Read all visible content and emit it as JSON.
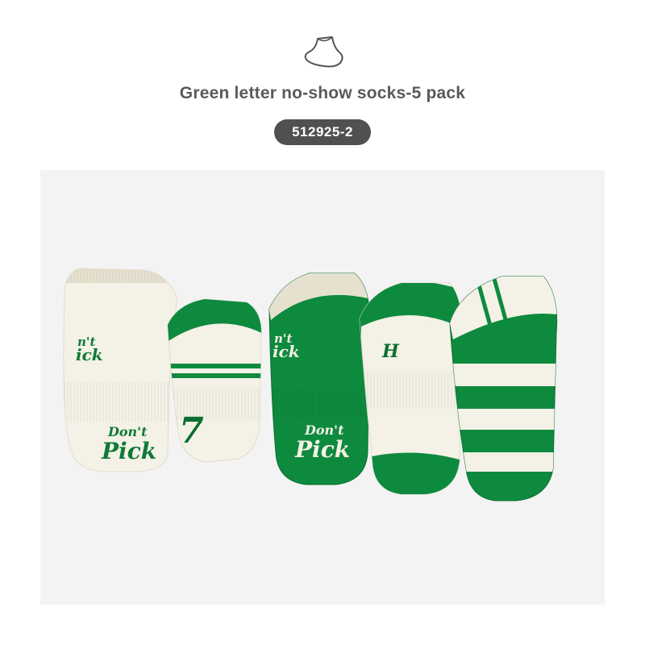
{
  "header": {
    "icon": "sock-outline-icon",
    "title": "Green letter no-show socks-5 pack",
    "item_code": "512925-2"
  },
  "colors": {
    "green": "#0e8a3e",
    "dark_green": "#0a6f31",
    "cream": "#f4f1e6",
    "panel_bg": "#f3f3f3",
    "badge_bg": "#505050",
    "title_text": "#5a5a5a"
  },
  "product": {
    "sock_prints": {
      "dont": "Don't",
      "pick": "Pick",
      "letter": "H",
      "number": "7",
      "crop_dont": "n't",
      "crop_pick": "ick"
    }
  }
}
